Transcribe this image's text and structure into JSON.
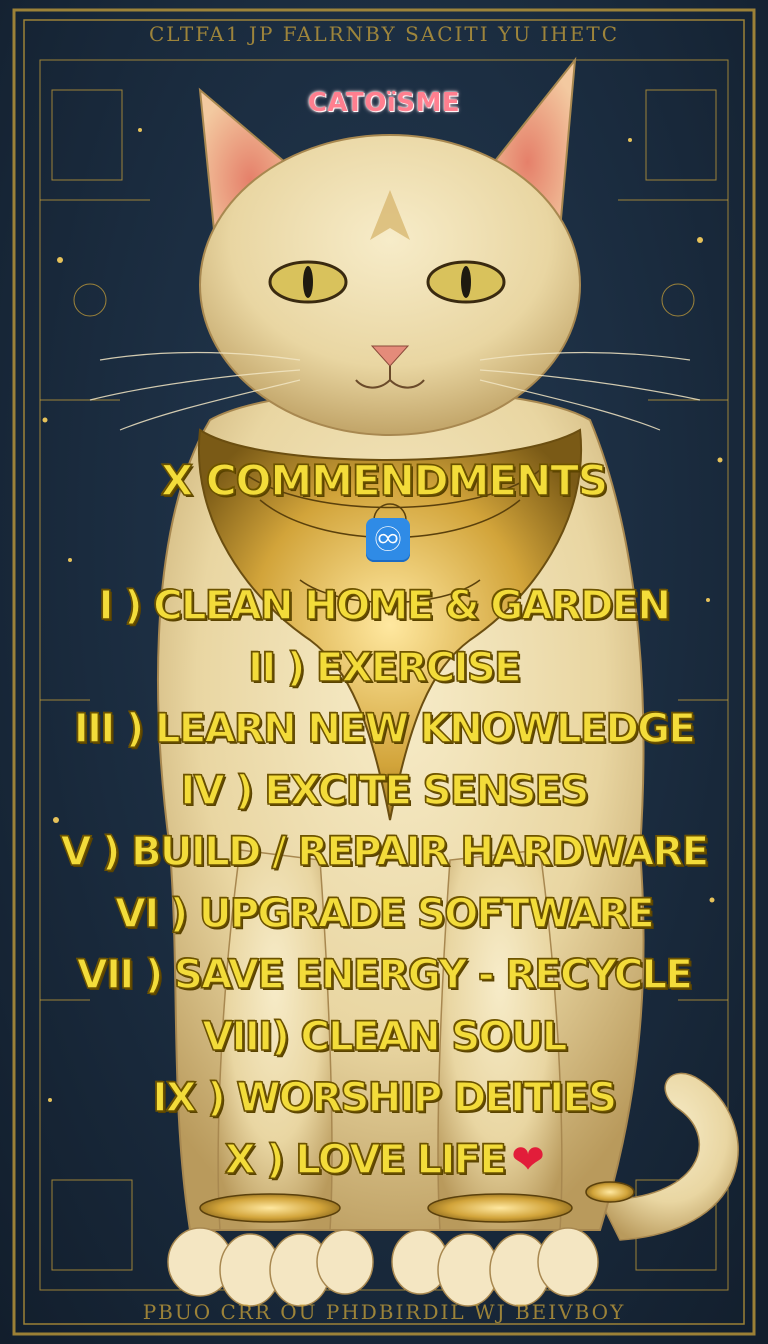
{
  "brand": "CATOïSME",
  "heading": "X COMMENDMENTS",
  "infinity_emoji": "♾",
  "commandments": [
    "I ) CLEAN HOME & GARDEN",
    "II ) EXERCISE",
    "III ) LEARN NEW KNOWLEDGE",
    "IV ) EXCITE SENSES",
    "V ) BUILD / REPAIR HARDWARE",
    "VI ) UPGRADE SOFTWARE",
    "VII ) SAVE ENERGY - RECYCLE",
    "VIII) CLEAN SOUL",
    "IX ) WORSHIP DEITIES",
    "X ) LOVE LIFE"
  ],
  "heart_emoji": "❤",
  "decorative_top_text": "CLTFA1 JP FALRNBY SACITI YU IHETC",
  "decorative_bottom_text": "PBUO CRR OU PHDBIRDIL WJ BEIVBOY",
  "colors": {
    "background": "#1b2a3a",
    "gold_text": "#f3dc3a",
    "gold_outline": "#6b5200",
    "brand_pink": "#ff7f8f",
    "frame_gold": "#c9a23a",
    "heart_red": "#e21d3a"
  }
}
